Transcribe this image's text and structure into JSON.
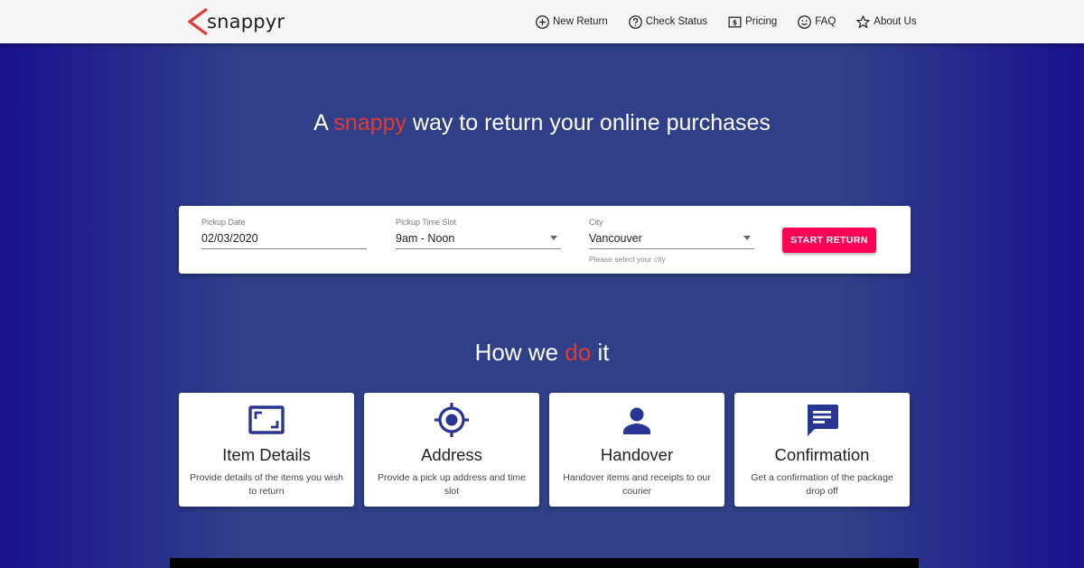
{
  "header": {
    "logo_text": "snappyr",
    "nav": [
      {
        "label": "New Return",
        "icon": "add-circle-icon"
      },
      {
        "label": "Check Status",
        "icon": "help-circle-icon"
      },
      {
        "label": "Pricing",
        "icon": "dollar-bill-icon"
      },
      {
        "label": "FAQ",
        "icon": "smiley-icon"
      },
      {
        "label": "About Us",
        "icon": "star-icon"
      }
    ]
  },
  "hero": {
    "title_pre": "A",
    "title_accent": "snappy",
    "title_post": "way to return your online purchases"
  },
  "form": {
    "pickup_date": {
      "label": "Pickup Date",
      "value": "02/03/2020"
    },
    "pickup_time": {
      "label": "Pickup Time Slot",
      "value": "9am - Noon"
    },
    "city": {
      "label": "City",
      "value": "Vancouver",
      "help": "Please select your city"
    },
    "start_button": "START RETURN"
  },
  "how": {
    "title_pre": "How we",
    "title_accent": "do",
    "title_post": "it",
    "steps": [
      {
        "title": "Item Details",
        "desc": "Provide details of the items you wish to return",
        "icon": "aspect-frame-icon"
      },
      {
        "title": "Address",
        "desc": "Provide a pick up address and time slot",
        "icon": "gps-target-icon"
      },
      {
        "title": "Handover",
        "desc": "Handover items and receipts to our courier",
        "icon": "person-icon"
      },
      {
        "title": "Confirmation",
        "desc": "Get a confirmation of the package drop off",
        "icon": "message-icon"
      }
    ]
  },
  "colors": {
    "accent": "#e53935",
    "button": "#ff0057",
    "icon": "#283593",
    "background": "#2f4089"
  }
}
